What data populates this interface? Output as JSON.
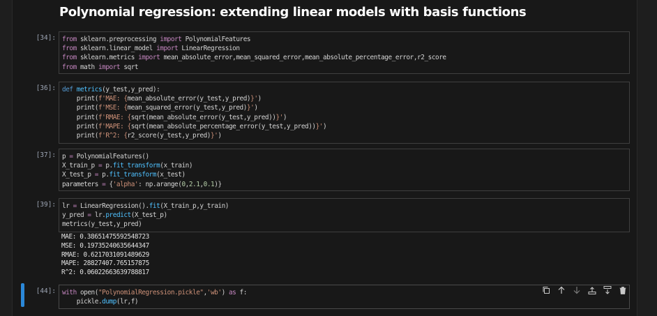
{
  "title": "Polynomial regression: extending linear models with basis functions",
  "cells": [
    {
      "prompt": "[34]:",
      "lines": [
        [
          [
            "kw",
            "from"
          ],
          [
            "p",
            " sklearn.preprocessing "
          ],
          [
            "kw",
            "import"
          ],
          [
            "p",
            " PolynomialFeatures"
          ]
        ],
        [
          [
            "kw",
            "from"
          ],
          [
            "p",
            " sklearn.linear_model "
          ],
          [
            "kw",
            "import"
          ],
          [
            "p",
            " LinearRegression"
          ]
        ],
        [
          [
            "kw",
            "from"
          ],
          [
            "p",
            " sklearn.metrics "
          ],
          [
            "kw",
            "import"
          ],
          [
            "p",
            " mean_absolute_error,mean_squared_error,mean_absolute_percentage_error,r2_score"
          ]
        ],
        [
          [
            "kw",
            "from"
          ],
          [
            "p",
            " math "
          ],
          [
            "kw",
            "import"
          ],
          [
            "p",
            " sqrt"
          ]
        ]
      ]
    },
    {
      "prompt": "[36]:",
      "lines": [
        [
          [
            "kw2",
            "def"
          ],
          [
            "p",
            " "
          ],
          [
            "meth",
            "metrics"
          ],
          [
            "p",
            "(y_test,y_pred):"
          ]
        ],
        [
          [
            "p",
            "    print("
          ],
          [
            "str",
            "f'MAE: {"
          ],
          [
            "p",
            "mean_absolute_error(y_test,y_pred)"
          ],
          [
            "str",
            "}'"
          ],
          [
            "p",
            ")"
          ]
        ],
        [
          [
            "p",
            "    print("
          ],
          [
            "str",
            "f'MSE: {"
          ],
          [
            "p",
            "mean_squared_error(y_test,y_pred)"
          ],
          [
            "str",
            "}'"
          ],
          [
            "p",
            ")"
          ]
        ],
        [
          [
            "p",
            "    print("
          ],
          [
            "str",
            "f'RMAE: {"
          ],
          [
            "p",
            "sqrt(mean_absolute_error(y_test,y_pred))"
          ],
          [
            "str",
            "}'"
          ],
          [
            "p",
            ")"
          ]
        ],
        [
          [
            "p",
            "    print("
          ],
          [
            "str",
            "f'MAPE: {"
          ],
          [
            "p",
            "sqrt(mean_absolute_percentage_error(y_test,y_pred))"
          ],
          [
            "str",
            "}'"
          ],
          [
            "p",
            ")"
          ]
        ],
        [
          [
            "p",
            "    print("
          ],
          [
            "str",
            "f'R^2: {"
          ],
          [
            "p",
            "r2_score(y_test,y_pred)"
          ],
          [
            "str",
            "}'"
          ],
          [
            "p",
            ")"
          ]
        ]
      ]
    },
    {
      "prompt": "[37]:",
      "lines": [
        [
          [
            "p",
            "p "
          ],
          [
            "op",
            "="
          ],
          [
            "p",
            " PolynomialFeatures()"
          ]
        ],
        [
          [
            "p",
            "X_train_p "
          ],
          [
            "op",
            "="
          ],
          [
            "p",
            " p."
          ],
          [
            "meth",
            "fit_transform"
          ],
          [
            "p",
            "(x_train)"
          ]
        ],
        [
          [
            "p",
            "X_test_p "
          ],
          [
            "op",
            "="
          ],
          [
            "p",
            " p."
          ],
          [
            "meth",
            "fit_transform"
          ],
          [
            "p",
            "(x_test)"
          ]
        ],
        [
          [
            "p",
            "parameters "
          ],
          [
            "op",
            "="
          ],
          [
            "p",
            " {"
          ],
          [
            "str",
            "'alpha'"
          ],
          [
            "p",
            ": np.arange("
          ],
          [
            "num",
            "0"
          ],
          [
            "p",
            ","
          ],
          [
            "num",
            "2.1"
          ],
          [
            "p",
            ","
          ],
          [
            "num",
            "0.1"
          ],
          [
            "p",
            ")}"
          ]
        ]
      ]
    },
    {
      "prompt": "[39]:",
      "lines": [
        [
          [
            "p",
            "lr "
          ],
          [
            "op",
            "="
          ],
          [
            "p",
            " LinearRegression()."
          ],
          [
            "meth",
            "fit"
          ],
          [
            "p",
            "(X_train_p,y_train)"
          ]
        ],
        [
          [
            "p",
            "y_pred "
          ],
          [
            "op",
            "="
          ],
          [
            "p",
            " lr."
          ],
          [
            "meth",
            "predict"
          ],
          [
            "p",
            "(X_test_p)"
          ]
        ],
        [
          [
            "p",
            "metrics(y_test,y_pred)"
          ]
        ]
      ],
      "output": [
        "MAE: 0.38651475592548723",
        "MSE: 0.19735240635644347",
        "RMAE: 0.6217031091489629",
        "MAPE: 28827407.765157875",
        "R^2: 0.06022663639788817"
      ]
    },
    {
      "prompt": "[44]:",
      "lines": [
        [
          [
            "kw",
            "with"
          ],
          [
            "p",
            " open("
          ],
          [
            "str",
            "\"PolynomialRegression.pickle\""
          ],
          [
            "p",
            ","
          ],
          [
            "str",
            "'wb'"
          ],
          [
            "p",
            ") "
          ],
          [
            "kw",
            "as"
          ],
          [
            "p",
            " f:"
          ]
        ],
        [
          [
            "p",
            "    pickle."
          ],
          [
            "meth",
            "dump"
          ],
          [
            "p",
            "(lr,f)"
          ]
        ]
      ]
    }
  ],
  "toolbar": [
    "copy-icon",
    "arrow-up-icon",
    "arrow-down-icon",
    "insert-above-icon",
    "insert-below-icon",
    "trash-icon"
  ],
  "colors": {
    "accent": "#2b88d8",
    "keyword": "#c586c0",
    "string": "#ce9178",
    "function": "#4fc1ff",
    "number": "#b5cea8"
  }
}
